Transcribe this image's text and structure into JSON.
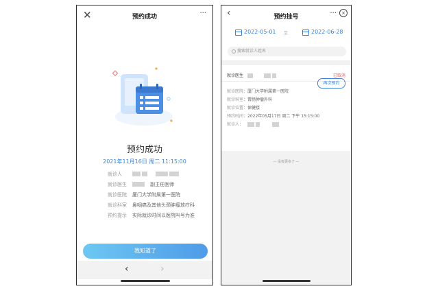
{
  "left": {
    "header": {
      "title": "预约成功",
      "close_icon": "close-icon",
      "more_label": "···"
    },
    "success_title": "预约成功",
    "datetime": "2021年11月16日 周二 11:15:00",
    "rows": [
      {
        "label": "就诊人",
        "value": ""
      },
      {
        "label": "就诊医生",
        "value": "副主任医师"
      },
      {
        "label": "就诊医院",
        "value": "厦门大学附属第一医院"
      },
      {
        "label": "就诊科室",
        "value": "鼻咽癌及其他头颈肿瘤放疗科"
      },
      {
        "label": "预约提示",
        "value": "实际就诊时间以医院叫号为准"
      }
    ],
    "confirm_label": "我知道了",
    "nav": {
      "back": "‹",
      "forward": "›"
    },
    "colors": {
      "accent": "#3d83d6",
      "button_from": "#6cc8f2",
      "button_to": "#4f9be8"
    }
  },
  "right": {
    "header": {
      "back": "‹",
      "title": "预约挂号",
      "more_label": "···",
      "close_label": "×"
    },
    "date_from": "2022-05-01",
    "date_to_label": "至",
    "date_to": "2022-06-28",
    "search_placeholder": "搜索就诊人姓名",
    "card": {
      "head_label": "就诊医生",
      "status": "已取消",
      "rows": [
        {
          "label": "就诊医院：",
          "value": "厦门大学附属第一医院"
        },
        {
          "label": "就诊科室：",
          "value": "胃肠肿瘤外科"
        },
        {
          "label": "就诊位置：",
          "value": "保健楼"
        },
        {
          "label": "预约时间：",
          "value": "2022年05月17日 周二 下午 15:15:00"
        },
        {
          "label": "就诊人：",
          "value": ""
        }
      ],
      "again_label": "再次预约"
    },
    "no_more": "— 没有更多了 —",
    "colors": {
      "accent": "#3d83d6",
      "cancel": "#e35a5a"
    }
  }
}
